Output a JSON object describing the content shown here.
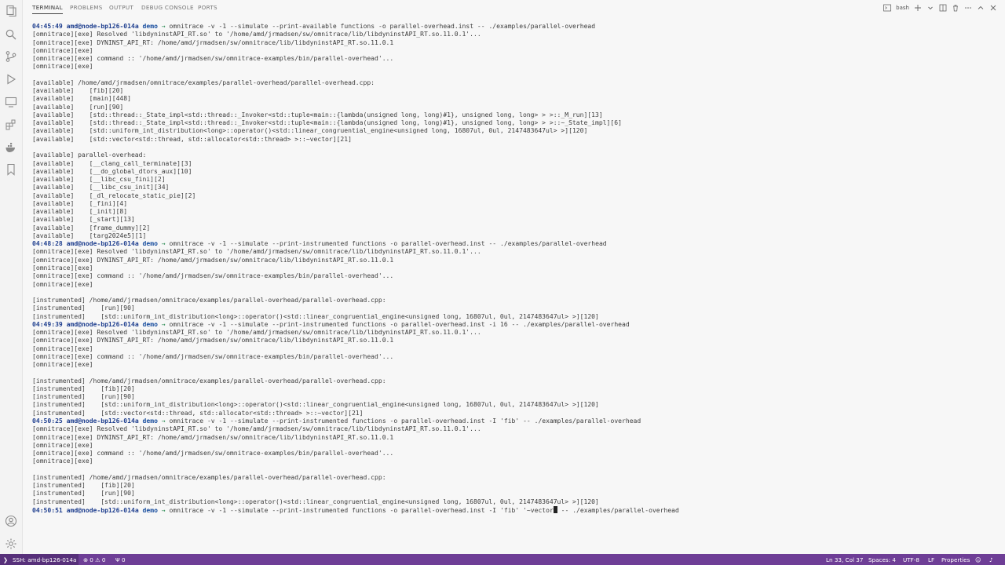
{
  "panel_tabs": [
    {
      "label": "TERMINAL",
      "active": true
    },
    {
      "label": "PROBLEMS",
      "active": false
    },
    {
      "label": "OUTPUT",
      "active": false
    },
    {
      "label": "DEBUG CONSOLE",
      "active": false
    },
    {
      "label": "PORTS",
      "active": false
    }
  ],
  "terminal_actions": {
    "shell_label": "bash"
  },
  "activity_icons": [
    "explorer-icon",
    "search-icon",
    "source-control-icon",
    "run-debug-icon",
    "remote-explorer-icon",
    "extensions-icon",
    "docker-icon",
    "bookmark-icon",
    "account-icon",
    "settings-gear-icon"
  ],
  "colors": {
    "statusbar": "#6e3e96",
    "remote_indicator": "#57307a",
    "prompt": "#1f3f8f",
    "arrow": "#2a8a52"
  },
  "terminal": {
    "lines": [
      {
        "type": "prompt",
        "time": "04:45:49",
        "host": "amd@node-bp126-014a",
        "dir": "demo",
        "cmd": "omnitrace -v -1 --simulate --print-available functions -o parallel-overhead.inst -- ./examples/parallel-overhead"
      },
      {
        "type": "text",
        "text": "[omnitrace][exe] Resolved 'libdyninstAPI_RT.so' to '/home/amd/jrmadsen/sw/omnitrace/lib/libdyninstAPI_RT.so.11.0.1'..."
      },
      {
        "type": "text",
        "text": "[omnitrace][exe] DYNINST_API_RT: /home/amd/jrmadsen/sw/omnitrace/lib/libdyninstAPI_RT.so.11.0.1"
      },
      {
        "type": "text",
        "text": "[omnitrace][exe]"
      },
      {
        "type": "text",
        "text": "[omnitrace][exe] command :: '/home/amd/jrmadsen/sw/omnitrace-examples/bin/parallel-overhead'..."
      },
      {
        "type": "text",
        "text": "[omnitrace][exe]"
      },
      {
        "type": "text",
        "text": ""
      },
      {
        "type": "text",
        "text": "[available] /home/amd/jrmadsen/omnitrace/examples/parallel-overhead/parallel-overhead.cpp:"
      },
      {
        "type": "text",
        "text": "[available]    [fib][20]"
      },
      {
        "type": "text",
        "text": "[available]    [main][448]"
      },
      {
        "type": "text",
        "text": "[available]    [run][90]"
      },
      {
        "type": "text",
        "text": "[available]    [std::thread::_State_impl<std::thread::_Invoker<std::tuple<main::{lambda(unsigned long, long)#1}, unsigned long, long> > >::_M_run][13]"
      },
      {
        "type": "text",
        "text": "[available]    [std::thread::_State_impl<std::thread::_Invoker<std::tuple<main::{lambda(unsigned long, long)#1}, unsigned long, long> > >::~_State_impl][6]"
      },
      {
        "type": "text",
        "text": "[available]    [std::uniform_int_distribution<long>::operator()<std::linear_congruential_engine<unsigned long, 16807ul, 0ul, 2147483647ul> >][120]"
      },
      {
        "type": "text",
        "text": "[available]    [std::vector<std::thread, std::allocator<std::thread> >::~vector][21]"
      },
      {
        "type": "text",
        "text": ""
      },
      {
        "type": "text",
        "text": "[available] parallel-overhead:"
      },
      {
        "type": "text",
        "text": "[available]    [__clang_call_terminate][3]"
      },
      {
        "type": "text",
        "text": "[available]    [__do_global_dtors_aux][10]"
      },
      {
        "type": "text",
        "text": "[available]    [__libc_csu_fini][2]"
      },
      {
        "type": "text",
        "text": "[available]    [__libc_csu_init][34]"
      },
      {
        "type": "text",
        "text": "[available]    [_dl_relocate_static_pie][2]"
      },
      {
        "type": "text",
        "text": "[available]    [_fini][4]"
      },
      {
        "type": "text",
        "text": "[available]    [_init][8]"
      },
      {
        "type": "text",
        "text": "[available]    [_start][13]"
      },
      {
        "type": "text",
        "text": "[available]    [frame_dummy][2]"
      },
      {
        "type": "text",
        "text": "[available]    [targ2024e5][1]"
      },
      {
        "type": "prompt",
        "time": "04:48:28",
        "host": "amd@node-bp126-014a",
        "dir": "demo",
        "cmd": "omnitrace -v -1 --simulate --print-instrumented functions -o parallel-overhead.inst -- ./examples/parallel-overhead"
      },
      {
        "type": "text",
        "text": "[omnitrace][exe] Resolved 'libdyninstAPI_RT.so' to '/home/amd/jrmadsen/sw/omnitrace/lib/libdyninstAPI_RT.so.11.0.1'..."
      },
      {
        "type": "text",
        "text": "[omnitrace][exe] DYNINST_API_RT: /home/amd/jrmadsen/sw/omnitrace/lib/libdyninstAPI_RT.so.11.0.1"
      },
      {
        "type": "text",
        "text": "[omnitrace][exe]"
      },
      {
        "type": "text",
        "text": "[omnitrace][exe] command :: '/home/amd/jrmadsen/sw/omnitrace-examples/bin/parallel-overhead'..."
      },
      {
        "type": "text",
        "text": "[omnitrace][exe]"
      },
      {
        "type": "text",
        "text": ""
      },
      {
        "type": "text",
        "text": "[instrumented] /home/amd/jrmadsen/omnitrace/examples/parallel-overhead/parallel-overhead.cpp:"
      },
      {
        "type": "text",
        "text": "[instrumented]    [run][90]"
      },
      {
        "type": "text",
        "text": "[instrumented]    [std::uniform_int_distribution<long>::operator()<std::linear_congruential_engine<unsigned long, 16807ul, 0ul, 2147483647ul> >][120]"
      },
      {
        "type": "prompt",
        "time": "04:49:39",
        "host": "amd@node-bp126-014a",
        "dir": "demo",
        "cmd": "omnitrace -v -1 --simulate --print-instrumented functions -o parallel-overhead.inst -i 16 -- ./examples/parallel-overhead"
      },
      {
        "type": "text",
        "text": "[omnitrace][exe] Resolved 'libdyninstAPI_RT.so' to '/home/amd/jrmadsen/sw/omnitrace/lib/libdyninstAPI_RT.so.11.0.1'..."
      },
      {
        "type": "text",
        "text": "[omnitrace][exe] DYNINST_API_RT: /home/amd/jrmadsen/sw/omnitrace/lib/libdyninstAPI_RT.so.11.0.1"
      },
      {
        "type": "text",
        "text": "[omnitrace][exe]"
      },
      {
        "type": "text",
        "text": "[omnitrace][exe] command :: '/home/amd/jrmadsen/sw/omnitrace-examples/bin/parallel-overhead'..."
      },
      {
        "type": "text",
        "text": "[omnitrace][exe]"
      },
      {
        "type": "text",
        "text": ""
      },
      {
        "type": "text",
        "text": "[instrumented] /home/amd/jrmadsen/omnitrace/examples/parallel-overhead/parallel-overhead.cpp:"
      },
      {
        "type": "text",
        "text": "[instrumented]    [fib][20]"
      },
      {
        "type": "text",
        "text": "[instrumented]    [run][90]"
      },
      {
        "type": "text",
        "text": "[instrumented]    [std::uniform_int_distribution<long>::operator()<std::linear_congruential_engine<unsigned long, 16807ul, 0ul, 2147483647ul> >][120]"
      },
      {
        "type": "text",
        "text": "[instrumented]    [std::vector<std::thread, std::allocator<std::thread> >::~vector][21]"
      },
      {
        "type": "prompt",
        "time": "04:50:25",
        "host": "amd@node-bp126-014a",
        "dir": "demo",
        "cmd": "omnitrace -v -1 --simulate --print-instrumented functions -o parallel-overhead.inst -I 'fib' -- ./examples/parallel-overhead"
      },
      {
        "type": "text",
        "text": "[omnitrace][exe] Resolved 'libdyninstAPI_RT.so' to '/home/amd/jrmadsen/sw/omnitrace/lib/libdyninstAPI_RT.so.11.0.1'..."
      },
      {
        "type": "text",
        "text": "[omnitrace][exe] DYNINST_API_RT: /home/amd/jrmadsen/sw/omnitrace/lib/libdyninstAPI_RT.so.11.0.1"
      },
      {
        "type": "text",
        "text": "[omnitrace][exe]"
      },
      {
        "type": "text",
        "text": "[omnitrace][exe] command :: '/home/amd/jrmadsen/sw/omnitrace-examples/bin/parallel-overhead'..."
      },
      {
        "type": "text",
        "text": "[omnitrace][exe]"
      },
      {
        "type": "text",
        "text": ""
      },
      {
        "type": "text",
        "text": "[instrumented] /home/amd/jrmadsen/omnitrace/examples/parallel-overhead/parallel-overhead.cpp:"
      },
      {
        "type": "text",
        "text": "[instrumented]    [fib][20]"
      },
      {
        "type": "text",
        "text": "[instrumented]    [run][90]"
      },
      {
        "type": "text",
        "text": "[instrumented]    [std::uniform_int_distribution<long>::operator()<std::linear_congruential_engine<unsigned long, 16807ul, 0ul, 2147483647ul> >][120]"
      },
      {
        "type": "prompt",
        "time": "04:50:51",
        "host": "amd@node-bp126-014a",
        "dir": "demo",
        "cmd": "omnitrace -v -1 --simulate --print-instrumented functions -o parallel-overhead.inst -I 'fib' '~vector",
        "cmd_after_cursor": "-- ./examples/parallel-overhead",
        "cursor": true
      }
    ]
  },
  "statusbar": {
    "remote": "SSH: amd-bp126-014a",
    "problems": "⊗ 0 ⚠ 0",
    "ports": "Ψ 0",
    "position": "Ln 33, Col 37",
    "spaces": "Spaces: 4",
    "encoding": "UTF-8",
    "eol": "LF",
    "language": "Properties"
  }
}
